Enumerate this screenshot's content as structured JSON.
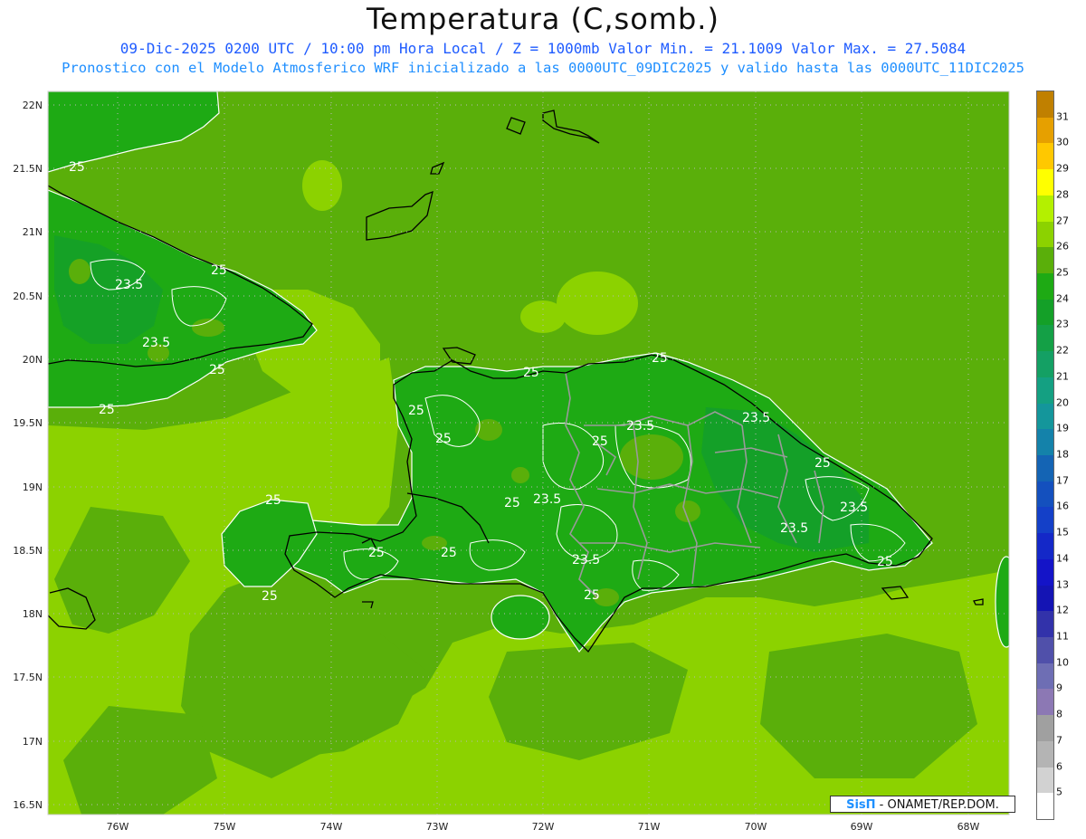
{
  "header": {
    "title": "Temperatura (C,somb.)",
    "line1": "09-Dic-2025 0200 UTC / 10:00 pm Hora Local / Z = 1000mb  Valor Min. = 21.1009  Valor Max. = 27.5084",
    "line2": "Pronostico con el Modelo Atmosferico WRF inicializado a las 0000UTC_09DIC2025 y valido hasta las  0000UTC_11DIC2025"
  },
  "map": {
    "lat_labels": [
      "22N",
      "21.5N",
      "21N",
      "20.5N",
      "20N",
      "19.5N",
      "19N",
      "18.5N",
      "18N",
      "17.5N",
      "17N",
      "16.5N"
    ],
    "lon_labels": [
      "76W",
      "75W",
      "74W",
      "73W",
      "72W",
      "71W",
      "70W",
      "69W",
      "68W"
    ],
    "contour_labels": [
      "25",
      "25",
      "23.5",
      "23.5",
      "25",
      "25",
      "25",
      "25",
      "25",
      "25",
      "23.5",
      "23.5",
      "25",
      "25",
      "23.5",
      "23.5",
      "23.5",
      "25",
      "25",
      "25",
      "25",
      "23.5",
      "25",
      "25",
      "25"
    ],
    "colors": {
      "t24": "#1eaa14",
      "t25": "#5aaf0a",
      "t26": "#8cd200",
      "t23": "#14a028",
      "t22": "#14a046"
    }
  },
  "colorbar": {
    "labels": [
      "31",
      "30",
      "29",
      "28",
      "27",
      "26",
      "25",
      "24",
      "23",
      "22",
      "21",
      "20",
      "19",
      "18",
      "17",
      "16",
      "15",
      "14",
      "13",
      "12",
      "11",
      "10",
      "9",
      "8",
      "7",
      "6",
      "5"
    ],
    "colors": [
      "#c08000",
      "#e6a000",
      "#ffc800",
      "#ffff00",
      "#b4f000",
      "#8cd200",
      "#5aaf0a",
      "#1eaa14",
      "#14a028",
      "#14a046",
      "#14a064",
      "#14a082",
      "#14969b",
      "#1482aa",
      "#1464b4",
      "#1450be",
      "#1440c8",
      "#1428c8",
      "#1414c8",
      "#1414b4",
      "#3232aa",
      "#5050aa",
      "#6e6eb4",
      "#8c78b4",
      "#a0a0a0",
      "#b4b4b4",
      "#d2d2d2",
      "#ffffff"
    ]
  },
  "credit": {
    "brand": "SisΠ",
    "text": "- ONAMET/REP.DOM."
  }
}
